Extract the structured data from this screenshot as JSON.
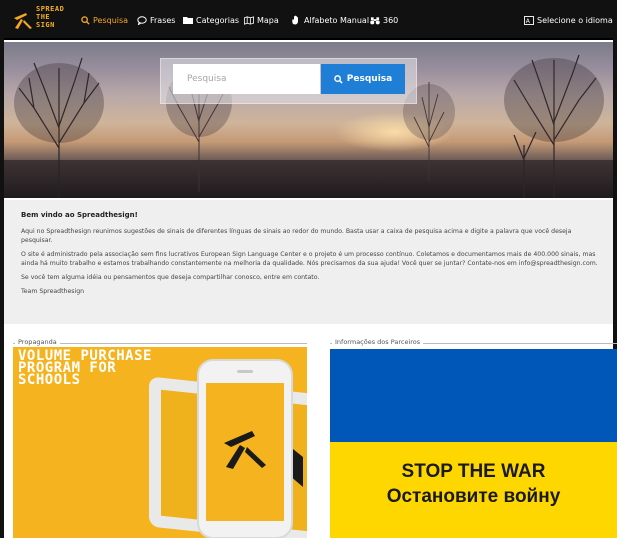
{
  "brand": {
    "logo_line1": "SPREAD",
    "logo_line2": "THE",
    "logo_line3": "SIGN",
    "accent": "#f5a623"
  },
  "nav": {
    "items": [
      {
        "label": "Pesquisa",
        "icon": "search-icon",
        "active": true
      },
      {
        "label": "Frases",
        "icon": "speech-bubble-icon"
      },
      {
        "label": "Categorias",
        "icon": "folder-icon"
      },
      {
        "label": "Mapa",
        "icon": "map-icon"
      },
      {
        "label": "Alfabeto Manual",
        "icon": "hand-icon"
      },
      {
        "label": "360",
        "icon": "binoculars-icon"
      }
    ],
    "language_label": "Selecione o idioma",
    "language_icon": "language-icon"
  },
  "hero": {
    "search_placeholder": "Pesquisa",
    "search_button_label": "Pesquisa",
    "search_button_color": "#1f7ed6"
  },
  "welcome": {
    "title": "Bem vindo ao Spreadthesign!",
    "para1": "Aqui no Spreadthesign reunimos sugestões de sinais de diferentes línguas de sinais ao redor do mundo. Basta usar a caixa de pesquisa acima e digite a palavra que você deseja pesquisar.",
    "para2": "O site é administrado pela associação sem fins lucrativos European Sign Language Center e o projeto é um processo contínuo. Coletamos e documentamos mais de 400.000 sinais, mas ainda há muito trabalho e estamos trabalhando constantemente na melhoria da qualidade. Nós precisamos da sua ajuda! Você quer se juntar? Contate-nos em info@spreadthesign.com.",
    "para3": "Se você tem alguma idéia ou pensamentos que deseja compartilhar conosco, entre em contato.",
    "signature": "Team Spreadthesign"
  },
  "sections": {
    "ad_legend": "Propaganda",
    "ad_line1": "VOLUME PURCHASE",
    "ad_line2": "PROGRAM FOR",
    "ad_line3": "SCHOOLS",
    "partners_legend": "Informações dos Parceiros",
    "banner_line1": "STOP THE WAR",
    "banner_line2": "Остановите войну"
  }
}
